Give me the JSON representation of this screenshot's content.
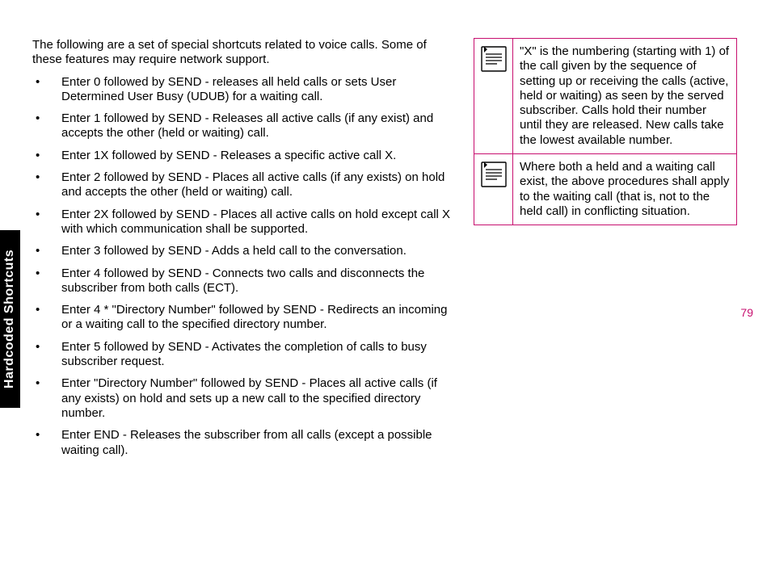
{
  "sideTab": "Hardcoded Shortcuts",
  "pageNumber": "79",
  "intro": " The following are a set of special shortcuts related to voice calls. Some of these features may require network support.",
  "bullets": [
    "Enter 0 followed by SEND - releases all held calls or sets User Determined User Busy (UDUB) for a waiting call.",
    "Enter 1 followed by SEND - Releases all active calls (if any exist) and accepts the other (held or waiting) call.",
    "Enter 1X followed by SEND - Releases a specific active call X.",
    "Enter 2 followed by SEND - Places all active calls (if any exists) on hold and accepts the other (held or waiting) call.",
    "Enter 2X followed by SEND - Places all active calls on hold except call X with which communication shall be             supported.",
    "Enter 3 followed by SEND - Adds a held call to the conversation.",
    "Enter 4 followed by SEND - Connects two calls and disconnects the subscriber from both calls (ECT).",
    "Enter 4 * \"Directory Number\" followed by SEND - Redirects an incoming or a waiting call to the specified directory number.",
    "Enter 5 followed by SEND - Activates the completion of calls to busy subscriber request.",
    "Enter \"Directory Number\" followed by SEND - Places all active calls (if any exists) on hold and sets up a new call to the specified directory number.",
    "Enter END - Releases the subscriber from all calls (except a possible waiting call)."
  ],
  "notes": [
    "\"X\" is the numbering (starting with 1) of the call given by the sequence of setting up or receiving the calls (active, held or waiting) as seen by the served subscriber. Calls hold their number until they are  released. New calls take the lowest available number.",
    "Where both a held and a waiting call exist, the above procedures shall apply to the waiting call (that is, not to the held call) in conflicting situation."
  ]
}
